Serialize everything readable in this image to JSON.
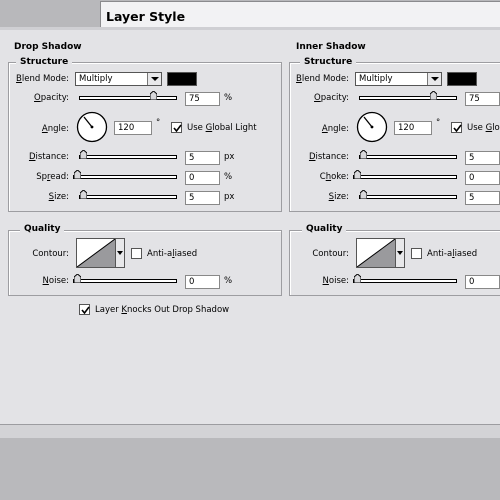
{
  "window": {
    "title": "Layer Style"
  },
  "drop_shadow": {
    "title": "Drop Shadow",
    "structure": {
      "legend": "Structure",
      "blend_mode": {
        "label": "Blend Mode:",
        "value": "Multiply",
        "color": "#000000"
      },
      "opacity": {
        "label": "Opacity:",
        "value": "75",
        "unit": "%",
        "slider_fraction": 0.75
      },
      "angle": {
        "label": "Angle:",
        "value": "120",
        "unit": "°",
        "global_light": {
          "label": "Use Global Light",
          "checked": true
        }
      },
      "distance": {
        "label": "Distance:",
        "value": "5",
        "unit": "px",
        "slider_fraction": 0.0
      },
      "spread": {
        "label": "Spread:",
        "value": "0",
        "unit": "%",
        "slider_fraction": 0.0
      },
      "size": {
        "label": "Size:",
        "value": "5",
        "unit": "px",
        "slider_fraction": 0.0
      }
    },
    "quality": {
      "legend": "Quality",
      "contour": {
        "label": "Contour:"
      },
      "anti_aliased": {
        "label": "Anti-aliased",
        "checked": false
      },
      "noise": {
        "label": "Noise:",
        "value": "0",
        "unit": "%",
        "slider_fraction": 0.0
      }
    },
    "knocks_out": {
      "label": "Layer Knocks Out Drop Shadow",
      "checked": true
    }
  },
  "inner_shadow": {
    "title": "Inner Shadow",
    "structure": {
      "legend": "Structure",
      "blend_mode": {
        "label": "Blend Mode:",
        "value": "Multiply",
        "color": "#000000"
      },
      "opacity": {
        "label": "Opacity:",
        "value": "75",
        "slider_fraction": 0.75
      },
      "angle": {
        "label": "Angle:",
        "value": "120",
        "unit": "°",
        "global_light": {
          "label": "Use Glo",
          "checked": true
        }
      },
      "distance": {
        "label": "Distance:",
        "value": "5",
        "slider_fraction": 0.0
      },
      "choke": {
        "label": "Choke:",
        "value": "0",
        "slider_fraction": 0.0
      },
      "size": {
        "label": "Size:",
        "value": "5",
        "slider_fraction": 0.0
      }
    },
    "quality": {
      "legend": "Quality",
      "contour": {
        "label": "Contour:"
      },
      "anti_aliased": {
        "label": "Anti-aliased",
        "checked": false
      },
      "noise": {
        "label": "Noise:",
        "value": "0",
        "slider_fraction": 0.0
      }
    }
  }
}
